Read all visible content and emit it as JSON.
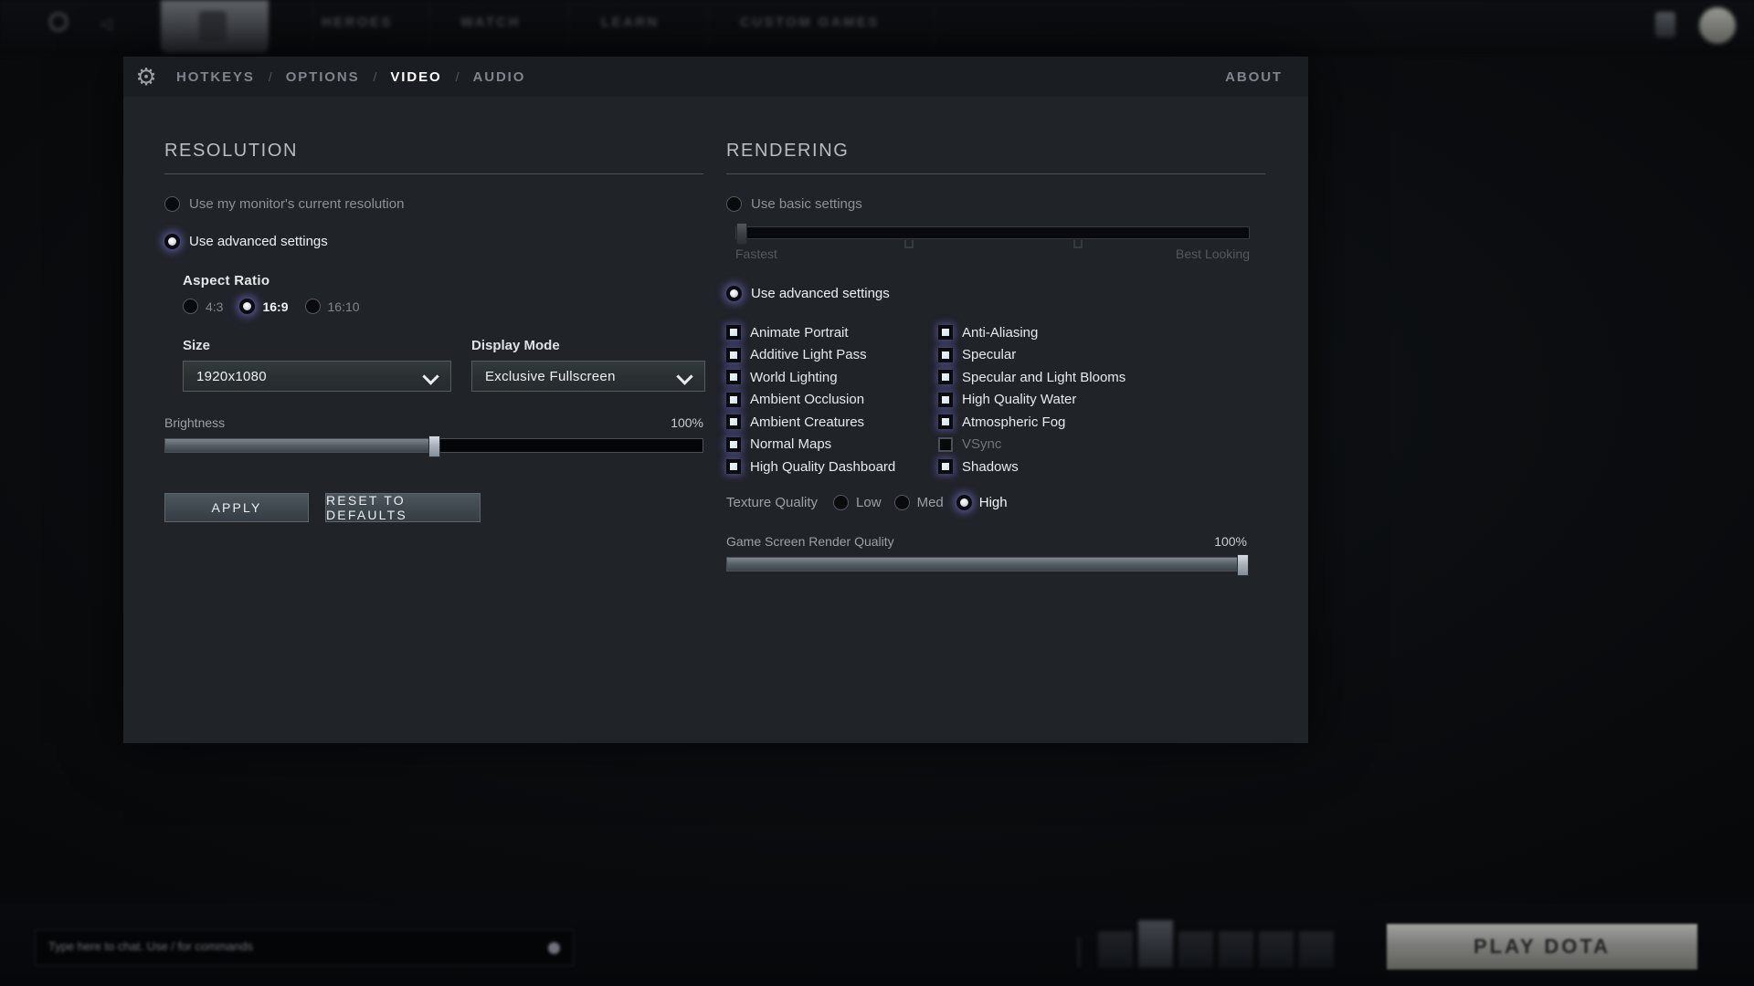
{
  "background": {
    "top_nav": {
      "items": [
        "HEROES",
        "WATCH",
        "LEARN",
        "CUSTOM GAMES"
      ],
      "gear_icon": "gear-icon",
      "back_icon": "back-arrow-icon",
      "logo": "dota-logo",
      "avatar": "user-avatar"
    },
    "bottom_bar": {
      "chat_placeholder": "Type here to chat. Use / for commands",
      "play_button": "PLAY DOTA"
    }
  },
  "panel": {
    "gear_icon": "gear-icon",
    "tabs": [
      {
        "label": "HOTKEYS",
        "active": false
      },
      {
        "label": "OPTIONS",
        "active": false
      },
      {
        "label": "VIDEO",
        "active": true
      },
      {
        "label": "AUDIO",
        "active": false
      }
    ],
    "tab_separator": "/",
    "about_label": "ABOUT"
  },
  "resolution": {
    "title": "RESOLUTION",
    "mode_options": [
      {
        "label": "Use my monitor's current resolution",
        "selected": false
      },
      {
        "label": "Use advanced settings",
        "selected": true
      }
    ],
    "aspect_ratio": {
      "label": "Aspect Ratio",
      "options": [
        {
          "label": "4:3",
          "selected": false
        },
        {
          "label": "16:9",
          "selected": true
        },
        {
          "label": "16:10",
          "selected": false
        }
      ]
    },
    "size": {
      "label": "Size",
      "value": "1920x1080"
    },
    "display_mode": {
      "label": "Display Mode",
      "value": "Exclusive Fullscreen"
    },
    "brightness": {
      "label": "Brightness",
      "value": "100%",
      "percent": 50
    },
    "apply_button": "APPLY",
    "reset_button": "RESET TO DEFAULTS"
  },
  "rendering": {
    "title": "RENDERING",
    "basic": {
      "label": "Use basic settings",
      "selected": false,
      "slider_percent": 0,
      "left_caption": "Fastest",
      "right_caption": "Best Looking"
    },
    "advanced": {
      "label": "Use advanced settings",
      "selected": true
    },
    "options_left": [
      {
        "label": "Animate Portrait",
        "checked": true,
        "enabled": true
      },
      {
        "label": "Additive Light Pass",
        "checked": true,
        "enabled": true
      },
      {
        "label": "World Lighting",
        "checked": true,
        "enabled": true
      },
      {
        "label": "Ambient Occlusion",
        "checked": true,
        "enabled": true
      },
      {
        "label": "Ambient Creatures",
        "checked": true,
        "enabled": true
      },
      {
        "label": "Normal Maps",
        "checked": true,
        "enabled": true
      },
      {
        "label": "High Quality Dashboard",
        "checked": true,
        "enabled": true
      }
    ],
    "options_right": [
      {
        "label": "Anti-Aliasing",
        "checked": true,
        "enabled": true
      },
      {
        "label": "Specular",
        "checked": true,
        "enabled": true
      },
      {
        "label": "Specular and Light Blooms",
        "checked": true,
        "enabled": true
      },
      {
        "label": "High Quality Water",
        "checked": true,
        "enabled": true
      },
      {
        "label": "Atmospheric Fog",
        "checked": true,
        "enabled": true
      },
      {
        "label": "VSync",
        "checked": false,
        "enabled": false
      },
      {
        "label": "Shadows",
        "checked": true,
        "enabled": true
      }
    ],
    "texture_quality": {
      "label": "Texture Quality",
      "options": [
        {
          "label": "Low",
          "selected": false
        },
        {
          "label": "Med",
          "selected": false
        },
        {
          "label": "High",
          "selected": true
        }
      ]
    },
    "render_quality": {
      "label": "Game Screen Render Quality",
      "value": "100%",
      "percent": 100
    }
  },
  "colors": {
    "panel_bg": "#202328",
    "header_bg": "#1a1d21",
    "accent_glow": "#7878dc",
    "active_tab": "#ffffff",
    "muted_text": "#80848c"
  }
}
